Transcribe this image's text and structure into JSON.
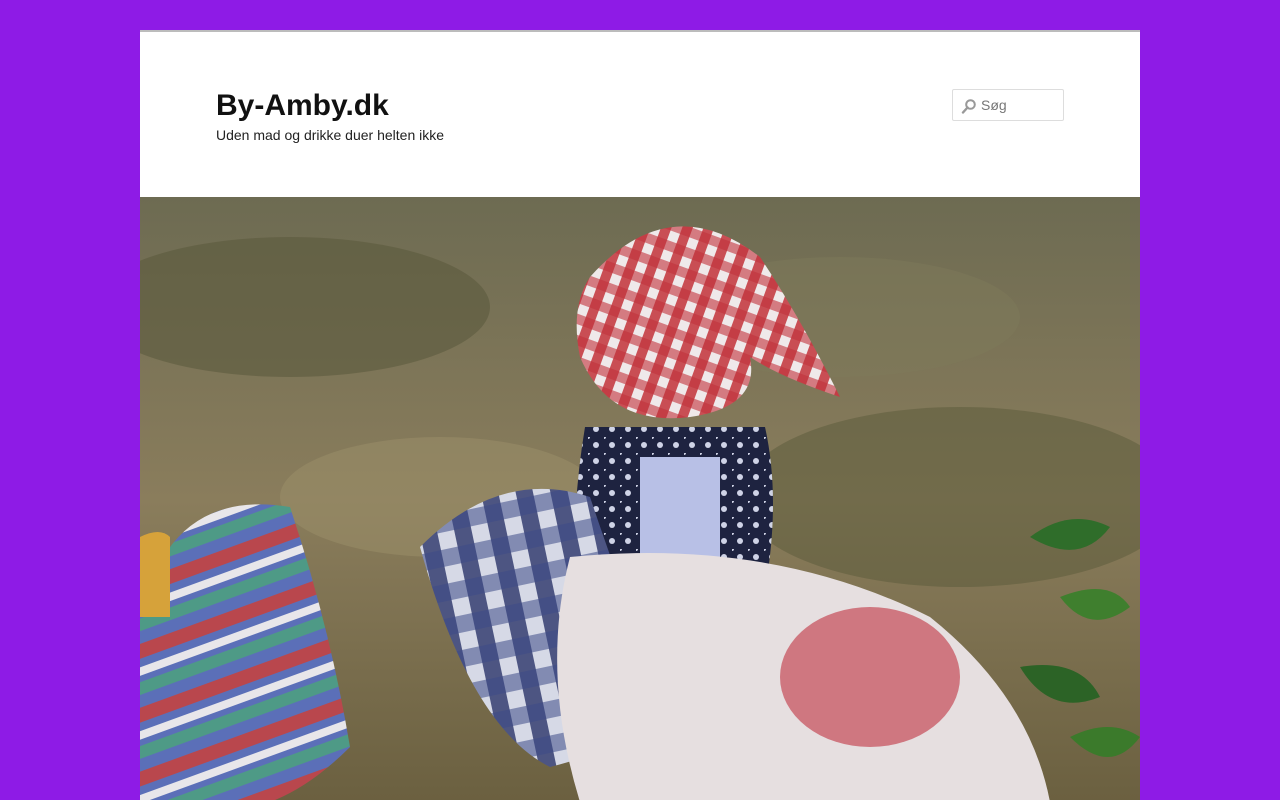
{
  "header": {
    "site_title": "By-Amby.dk",
    "site_description": "Uden mad og drikke duer helten ikke"
  },
  "search": {
    "placeholder": "Søg",
    "icon": "search-icon"
  },
  "colors": {
    "page_background": "#8e1be6",
    "content_background": "#ffffff",
    "title_text": "#111111"
  },
  "header_image": {
    "description_icon": "photo"
  }
}
